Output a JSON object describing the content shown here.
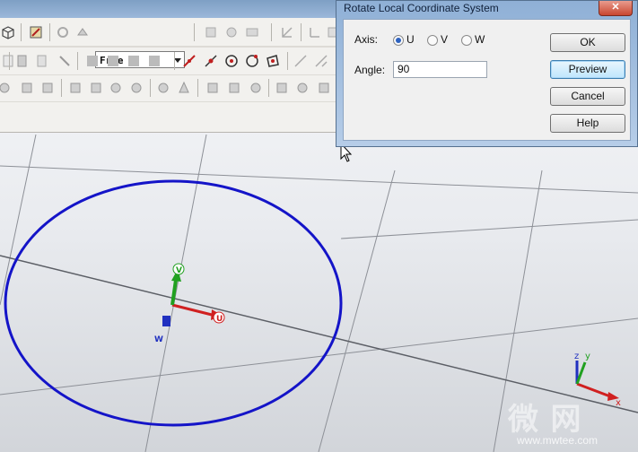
{
  "toolbar": {
    "mode_select_value": "Free",
    "row1_icons": [
      "cube-view-icon",
      "sketch-icon",
      "undo-redo-icon",
      "feature-icon-a",
      "feature-icon-b",
      "feature-icon-c",
      "dimension-icon",
      "transform-icon",
      "wcs-icon",
      "extra-icon"
    ],
    "row2_icons": [
      "sheet-icon",
      "document-icon",
      "pick-icon",
      "shape-icon-a",
      "shape-icon-b",
      "shape-icon-c",
      "shape-icon-d",
      "line-pick-icon",
      "point-pick-icon",
      "circle-center-icon",
      "circle-point-icon",
      "face-pick-icon",
      "edge-icon",
      "snap-icon"
    ],
    "row3_icons": [
      "op-icon-1",
      "op-icon-2",
      "op-icon-3",
      "op-icon-4",
      "op-icon-5",
      "op-icon-6",
      "op-icon-7",
      "op-icon-8",
      "op-icon-9",
      "op-icon-10",
      "op-icon-11",
      "op-icon-12",
      "op-icon-13",
      "op-icon-14"
    ]
  },
  "dialog": {
    "title": "Rotate Local Coordinate System",
    "close_label": "✕",
    "axis_label": "Axis:",
    "axis_options": [
      {
        "label": "U",
        "checked": true
      },
      {
        "label": "V",
        "checked": false
      },
      {
        "label": "W",
        "checked": false
      }
    ],
    "angle_label": "Angle:",
    "angle_value": "90",
    "buttons": {
      "ok": "OK",
      "preview": "Preview",
      "cancel": "Cancel",
      "help": "Help"
    }
  },
  "viewport": {
    "local_axes": {
      "u": "U",
      "v": "V",
      "w": "W"
    },
    "global_axes": {
      "x": "x",
      "y": "y",
      "z": "z"
    },
    "circle_color": "#1414c8",
    "u_color": "#d02020",
    "v_color": "#20a020",
    "w_color": "#2030c0"
  },
  "watermark": {
    "text": "微 网",
    "url": "www.mwtee.com"
  }
}
